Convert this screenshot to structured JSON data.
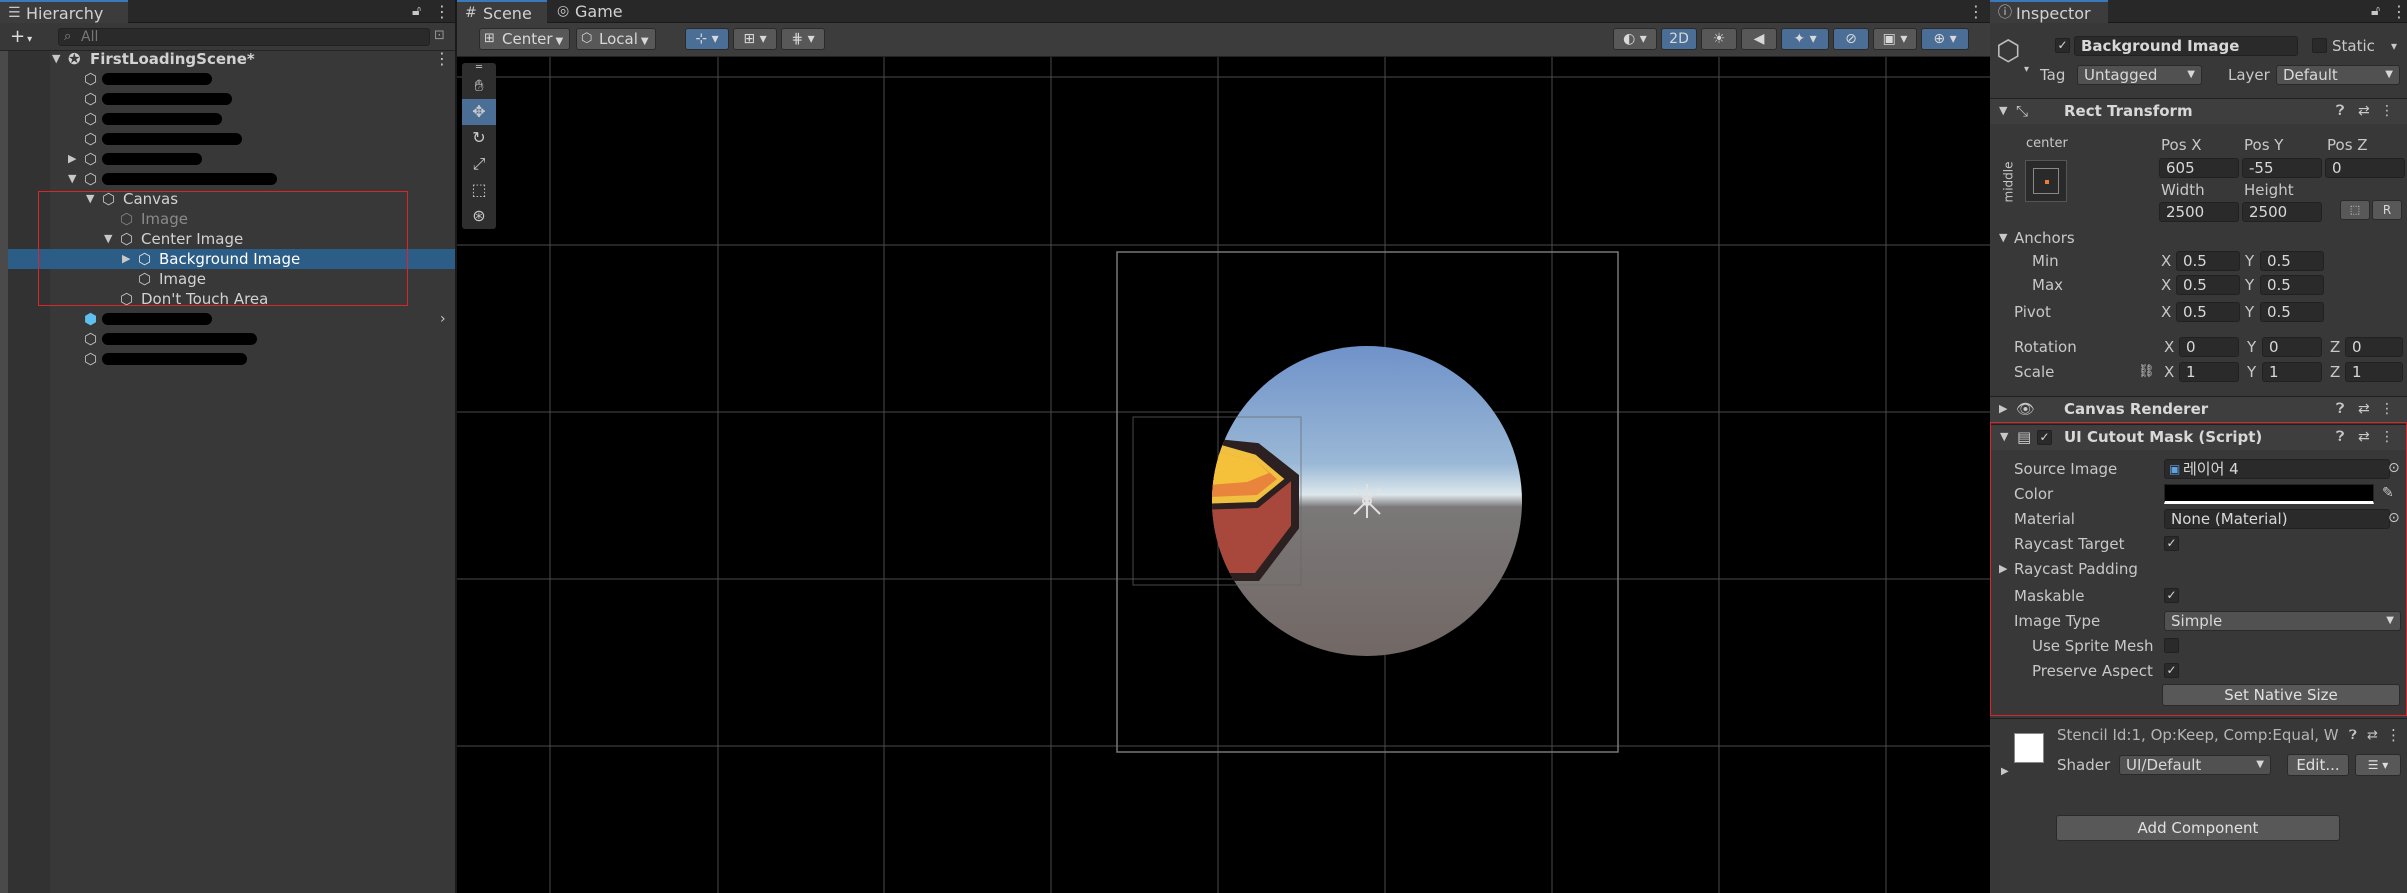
{
  "hierarchy": {
    "tab_label": "Hierarchy",
    "search_placeholder": "All",
    "add_label": "+",
    "scene_name": "FirstLoadingScene*",
    "items": [
      {
        "label": "Canvas"
      },
      {
        "label": "Image"
      },
      {
        "label": "Center Image"
      },
      {
        "label": "Background Image"
      },
      {
        "label": "Image"
      },
      {
        "label": "Don't Touch Area"
      }
    ]
  },
  "scene": {
    "tabs": [
      {
        "label": "Scene"
      },
      {
        "label": "Game"
      }
    ],
    "toolbar": {
      "pivot_mode": "Center",
      "pivot_rotation": "Local",
      "mode_2d": "2D"
    }
  },
  "inspector": {
    "tab_label": "Inspector",
    "object_name": "Background Image",
    "static_label": "Static",
    "tag_label": "Tag",
    "tag_value": "Untagged",
    "layer_label": "Layer",
    "layer_value": "Default",
    "rect_transform": {
      "title": "Rect Transform",
      "anchor_h": "center",
      "anchor_v": "middle",
      "pos_x_label": "Pos X",
      "pos_y_label": "Pos Y",
      "pos_z_label": "Pos Z",
      "pos_x": "605",
      "pos_y": "-55",
      "pos_z": "0",
      "width_label": "Width",
      "height_label": "Height",
      "width": "2500",
      "height": "2500",
      "raw_label": "R",
      "anchors_label": "Anchors",
      "min_label": "Min",
      "max_label": "Max",
      "pivot_label": "Pivot",
      "x_label": "X",
      "y_label": "Y",
      "z_label": "Z",
      "min_x": "0.5",
      "min_y": "0.5",
      "max_x": "0.5",
      "max_y": "0.5",
      "pivot_x": "0.5",
      "pivot_y": "0.5",
      "rotation_label": "Rotation",
      "rot_x": "0",
      "rot_y": "0",
      "rot_z": "0",
      "scale_label": "Scale",
      "scale_x": "1",
      "scale_y": "1",
      "scale_z": "1"
    },
    "canvas_renderer": {
      "title": "Canvas Renderer"
    },
    "cutout_mask": {
      "title": "UI Cutout Mask (Script)",
      "source_image_label": "Source Image",
      "source_image_value": "레이어 4",
      "color_label": "Color",
      "material_label": "Material",
      "material_value": "None (Material)",
      "raycast_target_label": "Raycast Target",
      "raycast_padding_label": "Raycast Padding",
      "maskable_label": "Maskable",
      "image_type_label": "Image Type",
      "image_type_value": "Simple",
      "use_sprite_mesh_label": "Use Sprite Mesh",
      "preserve_aspect_label": "Preserve Aspect",
      "set_native_size_label": "Set Native Size"
    },
    "material": {
      "stencil_text": "Stencil Id:1, Op:Keep, Comp:Equal, W",
      "shader_label": "Shader",
      "shader_value": "UI/Default",
      "edit_label": "Edit..."
    },
    "add_component_label": "Add Component"
  },
  "colors": {
    "selection": "#2c5d87",
    "accent": "#3a79bb",
    "highlight_box": "#d8262b"
  }
}
